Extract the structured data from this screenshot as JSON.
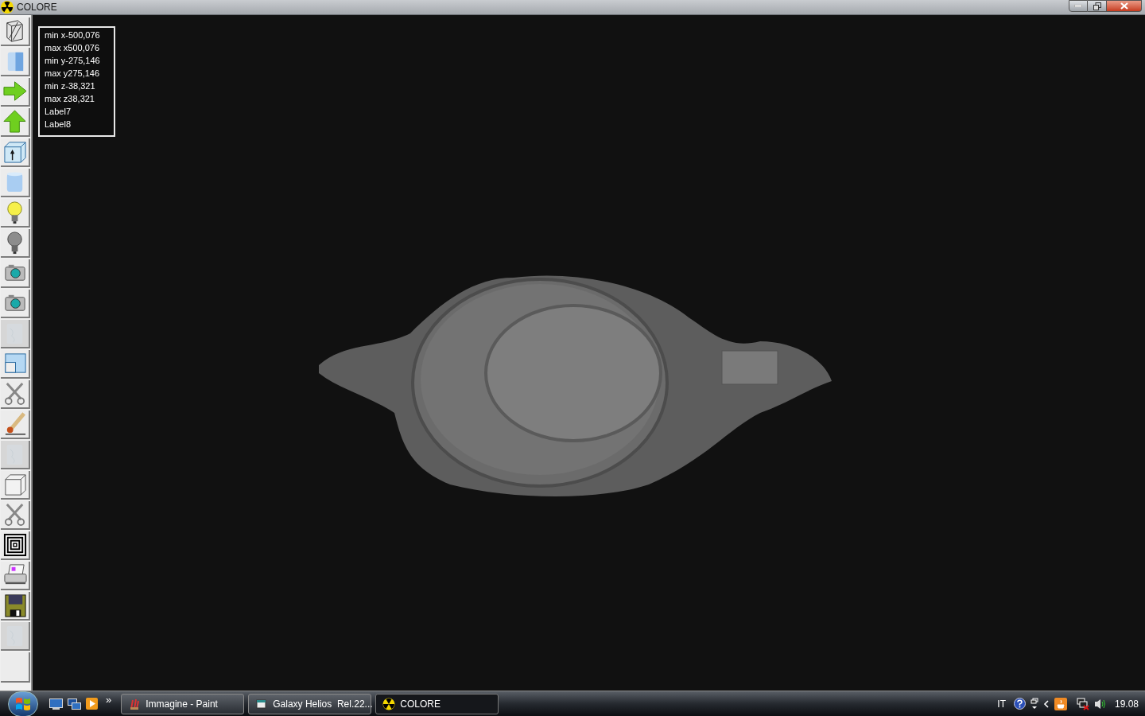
{
  "window": {
    "title": "COLORE"
  },
  "toolbar": [
    {
      "kind": "wireframe",
      "disabled": false
    },
    {
      "kind": "solid",
      "disabled": false
    },
    {
      "kind": "arrow-right",
      "disabled": false
    },
    {
      "kind": "arrow-up",
      "disabled": false
    },
    {
      "kind": "cube-arrow",
      "disabled": false
    },
    {
      "kind": "cylinder",
      "disabled": false
    },
    {
      "kind": "bulb-on",
      "disabled": false
    },
    {
      "kind": "bulb-off",
      "disabled": false
    },
    {
      "kind": "camera",
      "disabled": false
    },
    {
      "kind": "camera",
      "disabled": false
    },
    {
      "kind": "texture",
      "disabled": true
    },
    {
      "kind": "windows",
      "disabled": false
    },
    {
      "kind": "scissors",
      "disabled": false
    },
    {
      "kind": "brush",
      "disabled": false
    },
    {
      "kind": "texture",
      "disabled": true
    },
    {
      "kind": "cube",
      "disabled": false
    },
    {
      "kind": "scissors",
      "disabled": false
    },
    {
      "kind": "frames",
      "disabled": false
    },
    {
      "kind": "printer",
      "disabled": false
    },
    {
      "kind": "floppy",
      "disabled": false
    },
    {
      "kind": "texture",
      "disabled": true
    },
    {
      "kind": "empty",
      "disabled": false
    }
  ],
  "info_box": [
    "min x-500,076",
    "max x500,076",
    "min y-275,146",
    "max y275,146",
    "min z-38,321",
    "max z38,321",
    "Label7",
    "Label8"
  ],
  "taskbar": {
    "overflow": "»",
    "tasks": [
      {
        "label": "Immagine - Paint",
        "kind": "paint",
        "selected": false
      },
      {
        "label": "Galaxy Helios  Rel.22...",
        "kind": "helios",
        "selected": false
      },
      {
        "label": "COLORE",
        "kind": "colore",
        "selected": true
      }
    ],
    "language": "IT",
    "clock": "19.08"
  }
}
